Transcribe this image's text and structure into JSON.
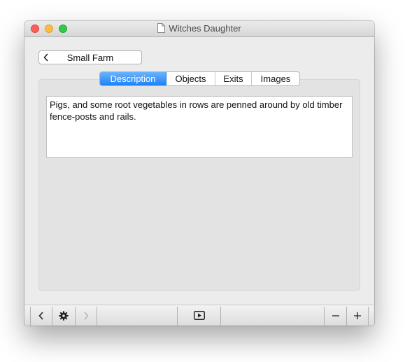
{
  "window": {
    "title": "Witches Daughter",
    "icons": {
      "close": "close-traffic-light",
      "minimize": "minimize-traffic-light",
      "zoom": "zoom-traffic-light",
      "document": "document-icon"
    }
  },
  "nav": {
    "back_label": "Small Farm",
    "back_icon": "chevron-left-icon"
  },
  "tabs": [
    {
      "label": "Description",
      "active": true
    },
    {
      "label": "Objects",
      "active": false
    },
    {
      "label": "Exits",
      "active": false
    },
    {
      "label": "Images",
      "active": false
    }
  ],
  "description": {
    "text": "Pigs, and some root vegetables in rows are penned around by old timber fence-posts and rails."
  },
  "toolbar": {
    "icons": [
      "chevron-left-icon",
      "gear-icon",
      "chevron-right-icon",
      "play-icon",
      "minus-icon",
      "plus-icon"
    ]
  },
  "colors": {
    "accent": "#1a82fb",
    "close": "#fc605c",
    "minimize": "#fdbc40",
    "zoom": "#34c84a"
  }
}
